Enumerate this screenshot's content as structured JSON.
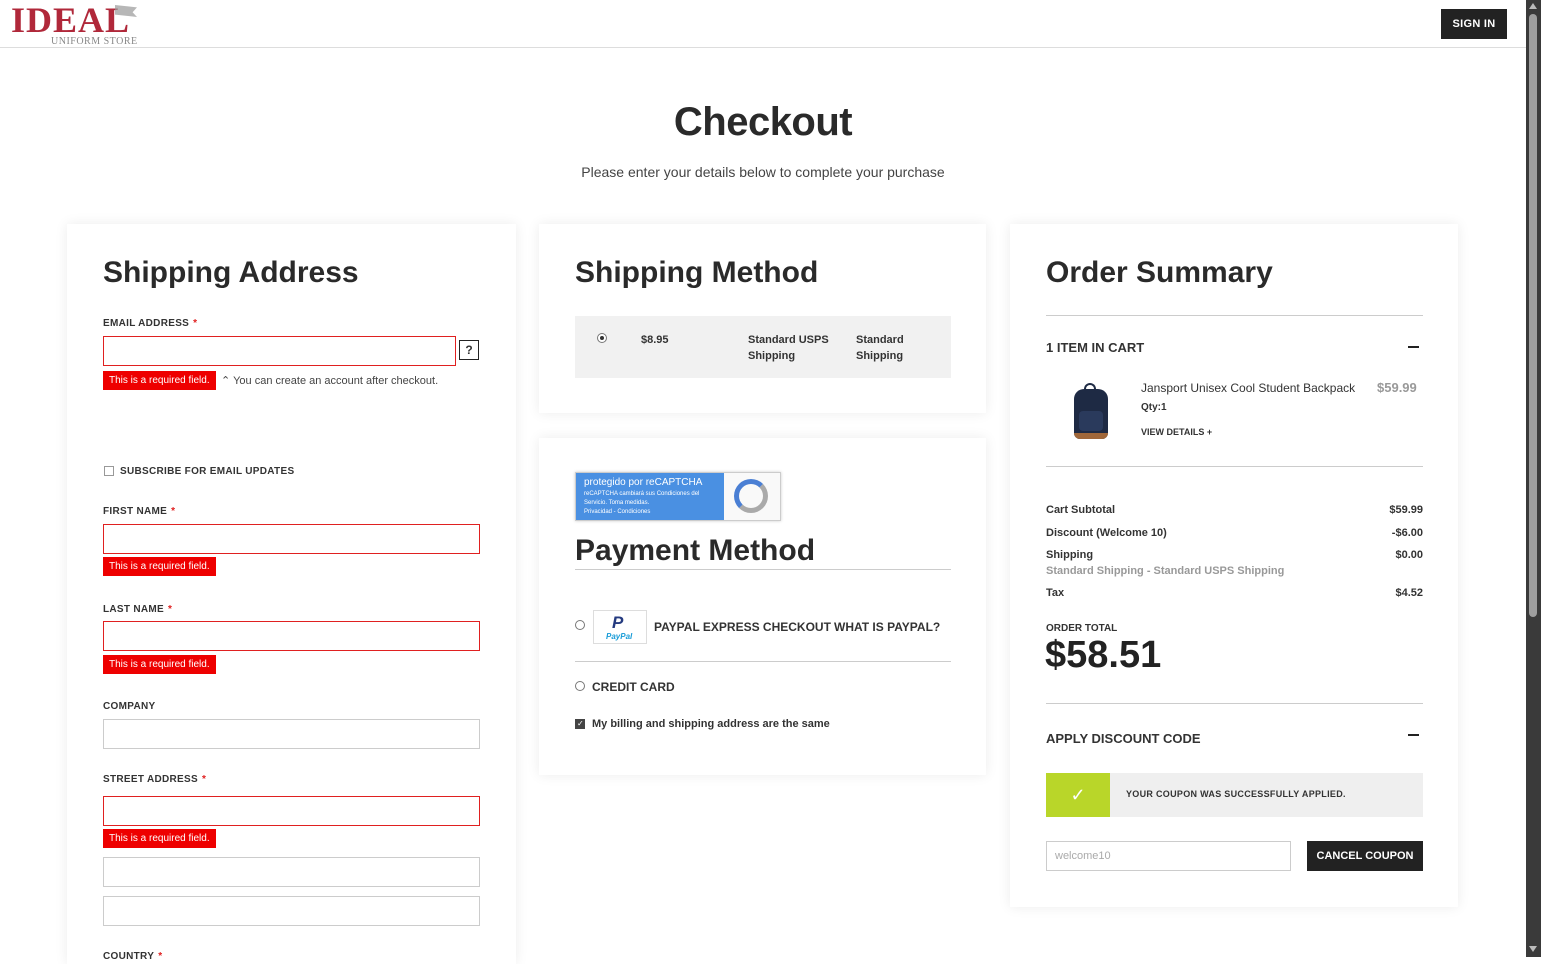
{
  "header": {
    "logo_main": "IDEAL",
    "logo_sub": "UNIFORM STORE",
    "signin_label": "SIGN IN"
  },
  "page": {
    "title": "Checkout",
    "subtitle": "Please enter your details below to complete your purchase"
  },
  "shipping_address": {
    "title": "Shipping Address",
    "email_label": "EMAIL ADDRESS",
    "required_mark": "*",
    "help_label": "?",
    "error_text": "This is a required field.",
    "account_note": "You can create an account after checkout.",
    "subscribe_label": "SUBSCRIBE FOR EMAIL UPDATES",
    "first_name_label": "FIRST NAME",
    "last_name_label": "LAST NAME",
    "company_label": "COMPANY",
    "street_label": "STREET ADDRESS",
    "country_label": "COUNTRY",
    "email_value": "",
    "first_name_value": "",
    "last_name_value": "",
    "company_value": "",
    "street_value": "",
    "street2_value": "",
    "street3_value": ""
  },
  "shipping_method": {
    "title": "Shipping Method",
    "price": "$8.95",
    "method": "Standard USPS Shipping",
    "carrier": "Standard Shipping"
  },
  "recaptcha": {
    "title": "protegido por reCAPTCHA",
    "body": "reCAPTCHA cambiará sus Condiciones del Servicio. Toma medidas.",
    "links": "Privacidad - Condiciones"
  },
  "payment_method": {
    "title": "Payment Method",
    "paypal_logo": "P",
    "paypal_logo_text": "PayPal",
    "paypal_label": "PAYPAL EXPRESS CHECKOUT",
    "what_is_paypal": "WHAT IS PAYPAL?",
    "credit_card_label": "CREDIT CARD",
    "billing_same_label": "My billing and shipping address are the same"
  },
  "order_summary": {
    "title": "Order Summary",
    "items_in_cart": "1 ITEM IN CART",
    "item": {
      "name": "Jansport Unisex Cool Student Backpack",
      "price": "$59.99",
      "qty": "Qty:1",
      "view_details": "VIEW DETAILS",
      "view_details_icon": "+"
    },
    "cart_subtotal_label": "Cart Subtotal",
    "cart_subtotal_value": "$59.99",
    "discount_label": "Discount (Welcome 10)",
    "discount_value": "-$6.00",
    "shipping_label": "Shipping",
    "shipping_value": "$0.00",
    "shipping_detail": "Standard Shipping - Standard USPS Shipping",
    "tax_label": "Tax",
    "tax_value": "$4.52",
    "order_total_label": "ORDER TOTAL",
    "order_total_value": "$58.51",
    "discount_code_title": "APPLY DISCOUNT CODE",
    "coupon_success": "YOUR COUPON WAS SUCCESSFULLY APPLIED.",
    "coupon_value": "welcome10",
    "cancel_coupon_label": "CANCEL COUPON"
  },
  "colors": {
    "error": "#e00000",
    "success": "#b9d629",
    "dark": "#222222",
    "brand": "#b0283a"
  }
}
